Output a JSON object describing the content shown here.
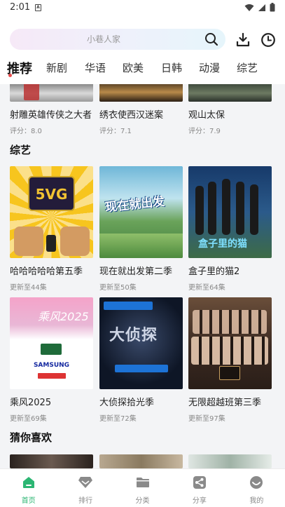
{
  "status": {
    "time": "2:01"
  },
  "search": {
    "placeholder": "小巷人家"
  },
  "tabs": [
    "推荐",
    "新剧",
    "华语",
    "欧美",
    "日韩",
    "动漫",
    "综艺"
  ],
  "top_row": [
    {
      "title": "射雕英雄传侠之大者",
      "sub": "评分：8.0"
    },
    {
      "title": "绣衣使西汉迷案",
      "sub": "评分：7.1"
    },
    {
      "title": "观山太保",
      "sub": "评分：7.9"
    }
  ],
  "variety": {
    "title": "综艺",
    "row1": [
      {
        "title": "哈哈哈哈哈第五季",
        "sub": "更新至44集",
        "poster_text": "5VG"
      },
      {
        "title": "现在就出发第二季",
        "sub": "更新至50集",
        "poster_text": "现在就出发"
      },
      {
        "title": "盒子里的猫2",
        "sub": "更新至64集",
        "poster_text": "盒子里的猫"
      }
    ],
    "row2": [
      {
        "title": "乘风2025",
        "sub": "更新至69集",
        "poster_text": "乘风2025",
        "poster_text2": "SAMSUNG"
      },
      {
        "title": "大侦探拾光季",
        "sub": "更新至72集",
        "poster_text": "大侦探"
      },
      {
        "title": "无限超越班第三季",
        "sub": "更新至97集",
        "poster_text": ""
      }
    ]
  },
  "guess": {
    "title": "猜你喜欢"
  },
  "tabbar": [
    {
      "label": "首页",
      "icon": "home-icon"
    },
    {
      "label": "排行",
      "icon": "diamond-icon"
    },
    {
      "label": "分类",
      "icon": "folder-icon"
    },
    {
      "label": "分享",
      "icon": "share-icon"
    },
    {
      "label": "我的",
      "icon": "profile-icon"
    }
  ],
  "colors": {
    "accent": "#2cb673",
    "tab_dot": "#e84b4b"
  }
}
